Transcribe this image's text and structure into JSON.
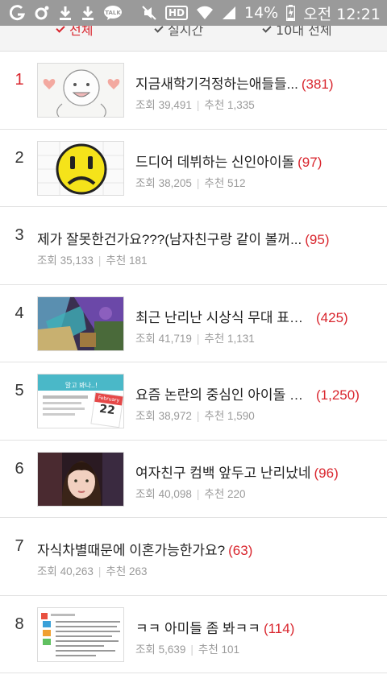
{
  "status_bar": {
    "battery": "14%",
    "time": "오전 12:21",
    "hd_label": "HD",
    "left_icons": [
      "g-app-icon",
      "k-app-icon",
      "download-icon",
      "download-icon",
      "talk-icon"
    ],
    "right_icons": [
      "mute-icon",
      "hd-icon",
      "wifi-icon",
      "signal-icon",
      "battery-charging-icon"
    ]
  },
  "tabs": [
    {
      "label": "전체",
      "active": true
    },
    {
      "label": "실시간",
      "active": false
    },
    {
      "label": "10대 전체",
      "active": false
    }
  ],
  "list": [
    {
      "rank": "1",
      "title": "지금새학기걱정하는애들들...",
      "comments": "(381)",
      "views_label": "조회",
      "views": "39,491",
      "recs_label": "추천",
      "recs": "1,335",
      "thumb": "drawing-face"
    },
    {
      "rank": "2",
      "title": "드디어 데뷔하는 신인아이돌",
      "comments": "(97)",
      "views_label": "조회",
      "views": "38,205",
      "recs_label": "추천",
      "recs": "512",
      "thumb": "yellow-face"
    },
    {
      "rank": "3",
      "title": "제가 잘못한건가요???(남자친구랑 같이 볼꺼...",
      "comments": "(95)",
      "views_label": "조회",
      "views": "35,133",
      "recs_label": "추천",
      "recs": "181",
      "thumb": ""
    },
    {
      "rank": "4",
      "title": "최근 난리난 시상식 무대 표절...",
      "comments": "(425)",
      "views_label": "조회",
      "views": "41,719",
      "recs_label": "추천",
      "recs": "1,131",
      "thumb": "stage-photo"
    },
    {
      "rank": "5",
      "title": "요즘 논란의 중심인 아이돌 표...",
      "comments": "(1,250)",
      "views_label": "조회",
      "views": "38,972",
      "recs_label": "추천",
      "recs": "1,590",
      "thumb": "calendar-card"
    },
    {
      "rank": "6",
      "title": "여자친구 컴백 앞두고 난리났네",
      "comments": "(96)",
      "views_label": "조회",
      "views": "40,098",
      "recs_label": "추천",
      "recs": "220",
      "thumb": "portrait-photo"
    },
    {
      "rank": "7",
      "title": "자식차별때문에 이혼가능한가요?",
      "comments": "(63)",
      "views_label": "조회",
      "views": "40,263",
      "recs_label": "추천",
      "recs": "263",
      "thumb": ""
    },
    {
      "rank": "8",
      "title": "ㅋㅋ 아미들 좀 봐ㅋㅋ",
      "comments": "(114)",
      "views_label": "조회",
      "views": "5,639",
      "recs_label": "추천",
      "recs": "101",
      "thumb": "text-screenshot"
    }
  ],
  "thumb_texts": {
    "calendar_header": "말고 봐나..!",
    "calendar_month": "February",
    "calendar_day": "22"
  },
  "colors": {
    "accent_red": "#d9262e",
    "status_bar": "#9a9a9a",
    "meta_gray": "#9a9a9a"
  }
}
